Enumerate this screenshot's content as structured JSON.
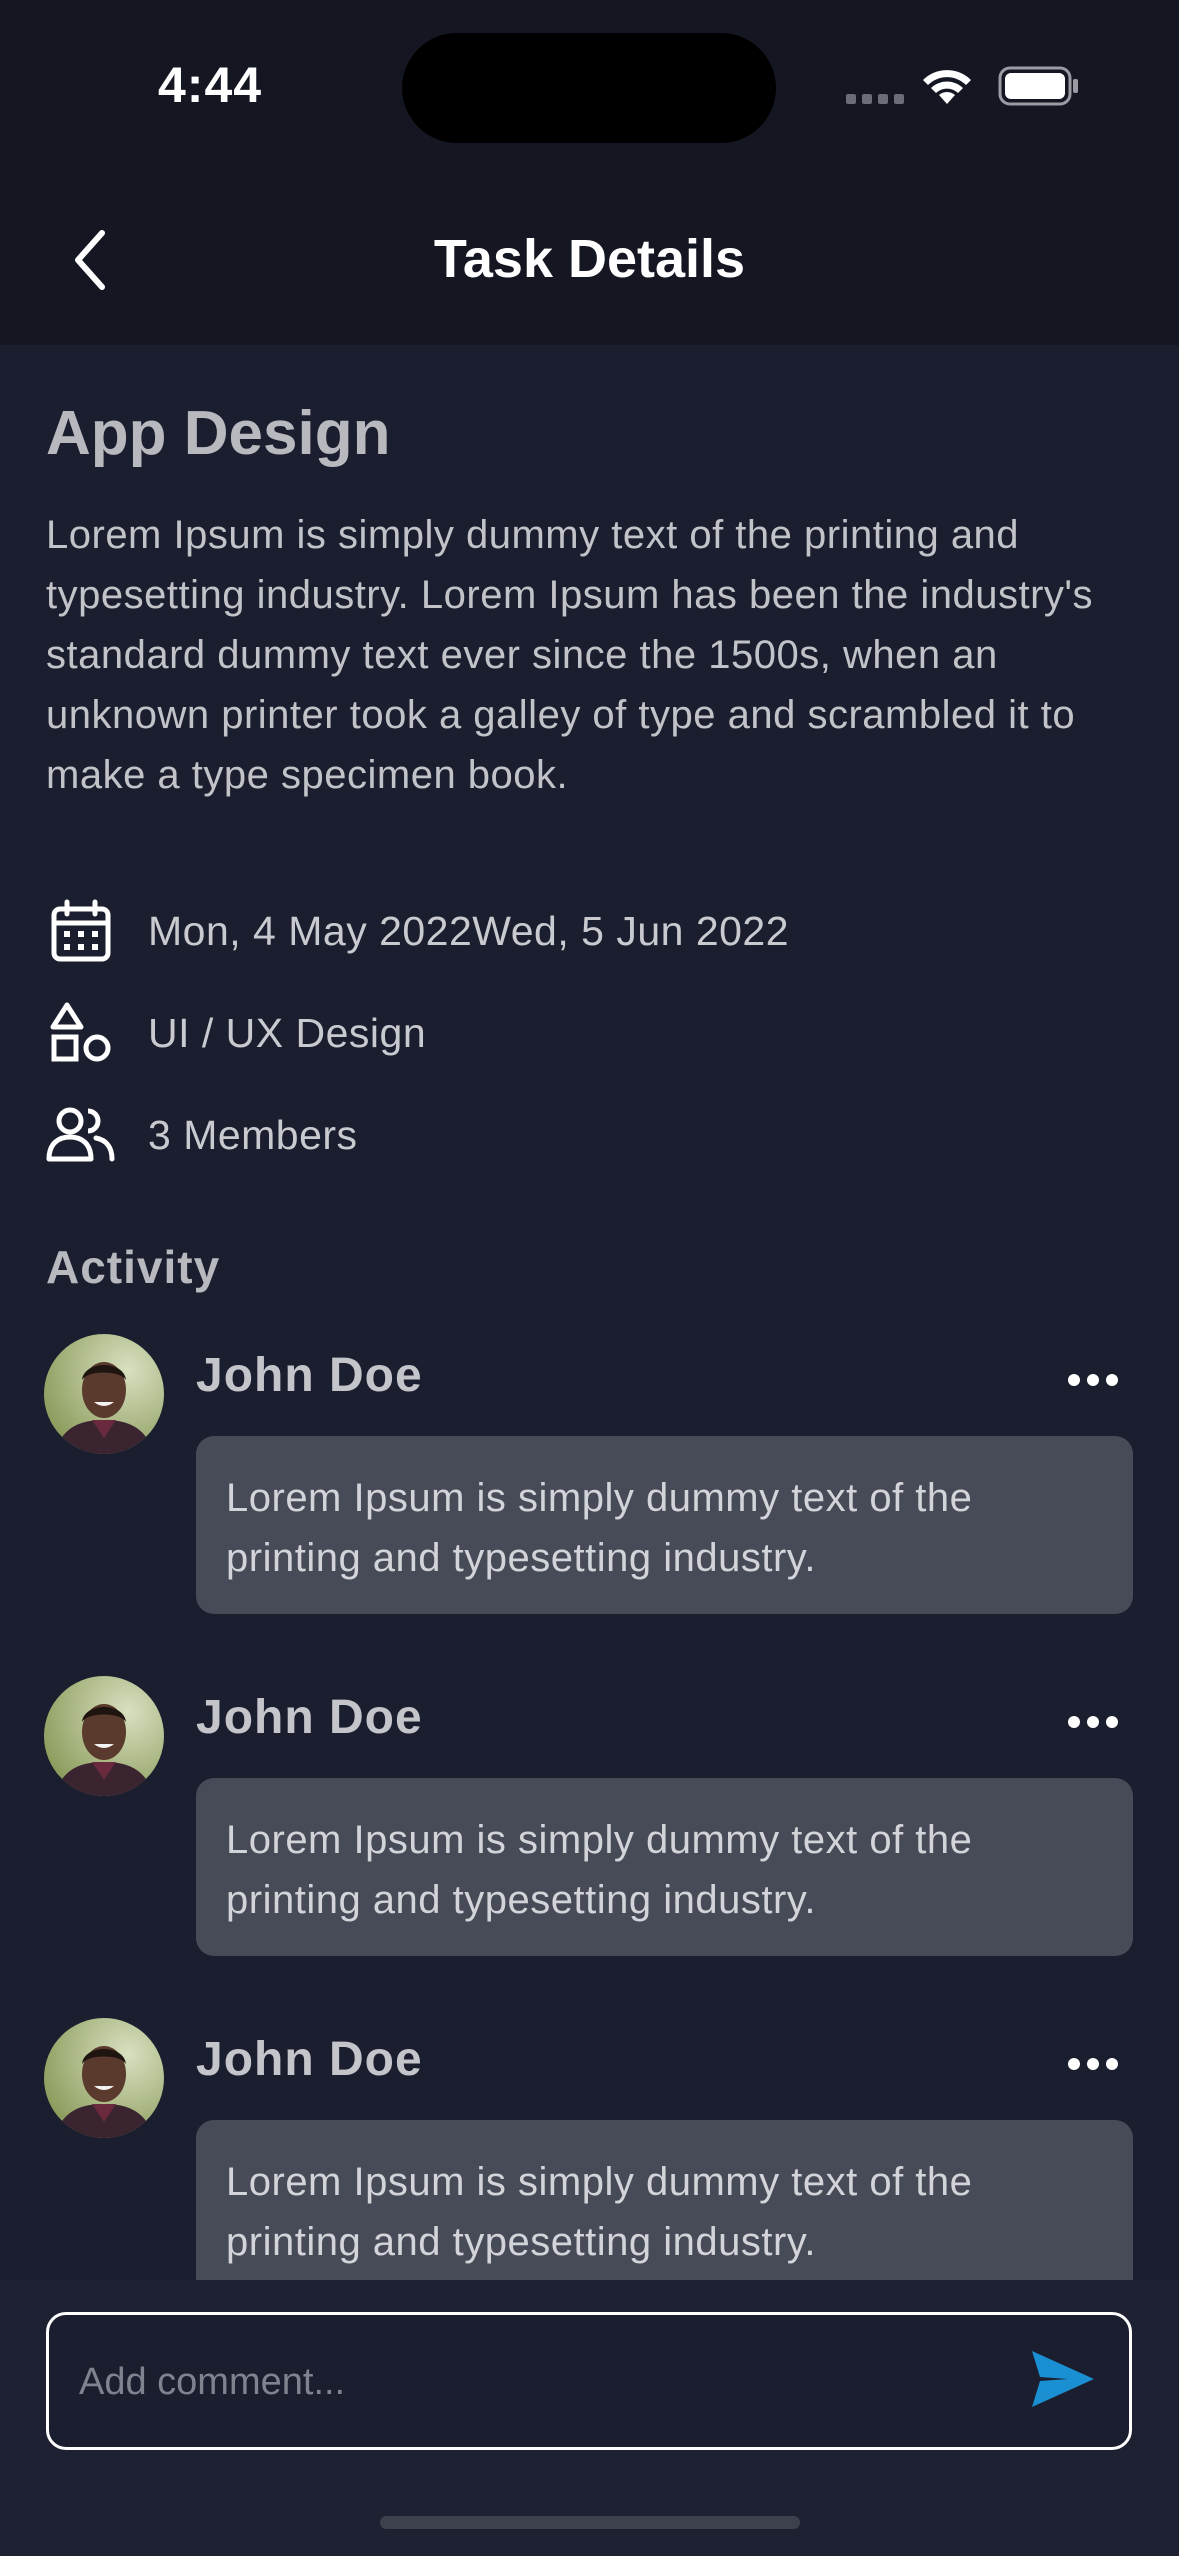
{
  "status_bar": {
    "time": "4:44"
  },
  "header": {
    "title": "Task Details",
    "back_icon": "chevron-left-icon"
  },
  "task": {
    "title": "App Design",
    "description": "Lorem Ipsum is simply dummy text of the printing and typesetting industry. Lorem Ipsum has been the industry's standard dummy text ever since the 1500s, when an unknown printer took a galley of type and scrambled it to make a type specimen book.",
    "dates": "Mon, 4 May 2022Wed, 5 Jun 2022",
    "category": "UI / UX Design",
    "members": "3 Members"
  },
  "activity": {
    "label": "Activity",
    "comments": [
      {
        "name": "John Doe",
        "text": "Lorem Ipsum is simply dummy text of the printing and typesetting industry."
      },
      {
        "name": "John Doe",
        "text": "Lorem Ipsum is simply dummy text of the printing and typesetting industry."
      },
      {
        "name": "John Doe",
        "text": "Lorem Ipsum is simply dummy text of the printing and typesetting industry."
      }
    ]
  },
  "comment_box": {
    "placeholder": "Add comment...",
    "send_icon": "send-icon"
  },
  "colors": {
    "background": "#1b1e2e",
    "header": "#141722",
    "bubble": "#474a57",
    "accent": "#1a8fd1"
  }
}
